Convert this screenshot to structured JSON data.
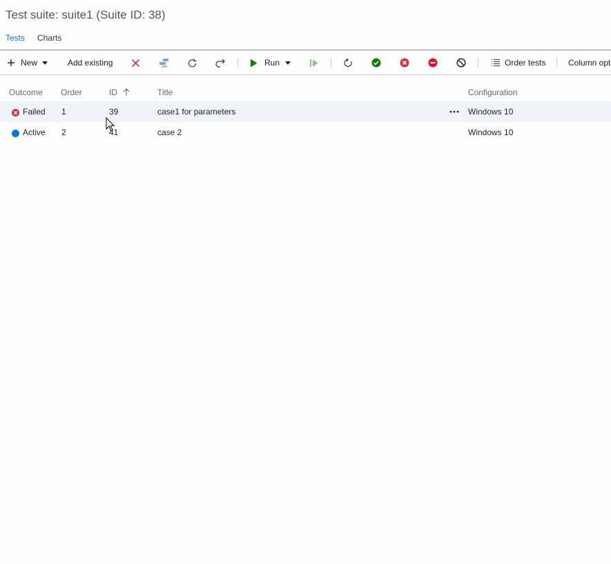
{
  "page": {
    "title": "Test suite: suite1 (Suite ID: 38)"
  },
  "tabs": [
    {
      "label": "Tests",
      "active": true
    },
    {
      "label": "Charts",
      "active": false
    }
  ],
  "toolbar": {
    "new_label": "New",
    "add_existing_label": "Add existing",
    "run_label": "Run",
    "order_tests_label": "Order tests",
    "column_options_label": "Column opt",
    "icons": {
      "new": "plus-icon",
      "remove": "remove-x-icon",
      "export": "export-icon",
      "refresh": "refresh-icon",
      "redo": "redo-icon",
      "run": "play-icon",
      "run_options": "play-bar-icon",
      "rerun": "rerun-icon",
      "pass": "check-circle-icon",
      "fail": "fail-circle-icon",
      "block": "block-circle-icon",
      "not_applicable": "not-applicable-icon",
      "order": "order-list-icon"
    }
  },
  "columns": {
    "outcome": "Outcome",
    "order": "Order",
    "id": "ID",
    "title": "Title",
    "configuration": "Configuration"
  },
  "rows": [
    {
      "outcome": "Failed",
      "order": "1",
      "id": "39",
      "title": "case1 for parameters",
      "configuration": "Windows 10",
      "selected": true
    },
    {
      "outcome": "Active",
      "order": "2",
      "id": "41",
      "title": "case 2",
      "configuration": "Windows 10",
      "selected": false
    }
  ],
  "colors": {
    "accent": "#106ebe",
    "failed": "#d13438",
    "active": "#0078d4",
    "pass": "#107c10",
    "block": "#e81123",
    "run": "#107c10"
  }
}
